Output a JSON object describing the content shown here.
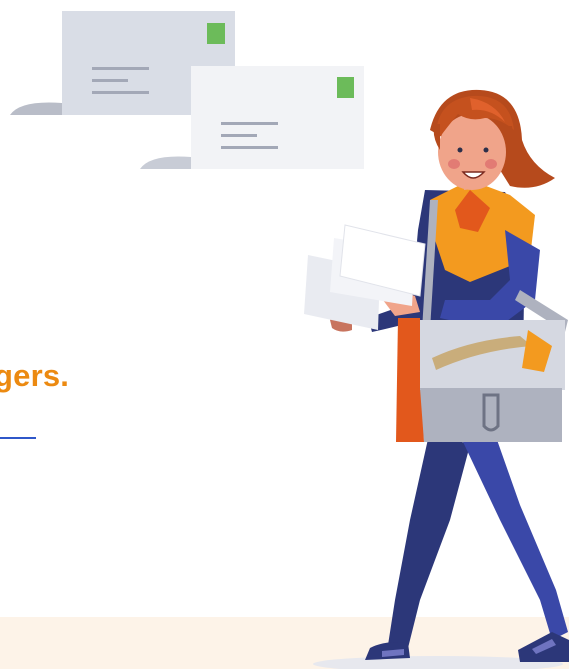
{
  "hero": {
    "headline_fragment": "gers."
  },
  "colors": {
    "accent_orange": "#ec8a11",
    "link_blue": "#2f57c9",
    "footer_band": "#fdf3e8",
    "stamp_green": "#6cbb5a",
    "envelope_back": "#d9dde6",
    "envelope_front": "#f2f3f6",
    "uniform_navy": "#2c3779",
    "bag_gray": "#aeb2bf"
  },
  "illustration": {
    "icons": [
      "envelope-icon",
      "envelope-icon",
      "mail-carrier-illustration"
    ]
  }
}
